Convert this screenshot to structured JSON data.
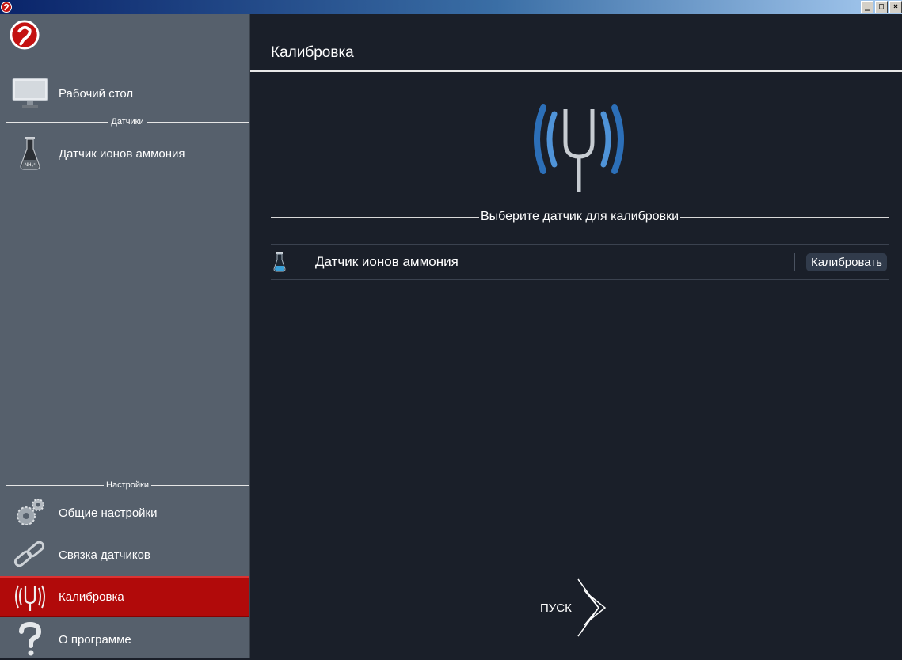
{
  "sidebar": {
    "items_top": [
      {
        "label": "Рабочий стол",
        "icon": "monitor-icon"
      }
    ],
    "sections": {
      "sensors": "Датчики",
      "settings": "Настройки"
    },
    "sensor_items": [
      {
        "label": "Датчик ионов аммония",
        "icon": "flask-icon"
      }
    ],
    "items_bottom": [
      {
        "label": "Общие настройки",
        "icon": "gears-icon"
      },
      {
        "label": "Связка датчиков",
        "icon": "chain-icon"
      },
      {
        "label": "Калибровка",
        "icon": "tuning-fork-icon",
        "active": true
      },
      {
        "label": "О программе",
        "icon": "question-icon"
      }
    ],
    "accent_color": "#b10a0a"
  },
  "main": {
    "title": "Калибровка",
    "choose_label": "Выберите датчик для калибровки",
    "sensor_row": {
      "name": "Датчик ионов аммония",
      "button": "Калибровать"
    },
    "start_label": "ПУСК"
  }
}
